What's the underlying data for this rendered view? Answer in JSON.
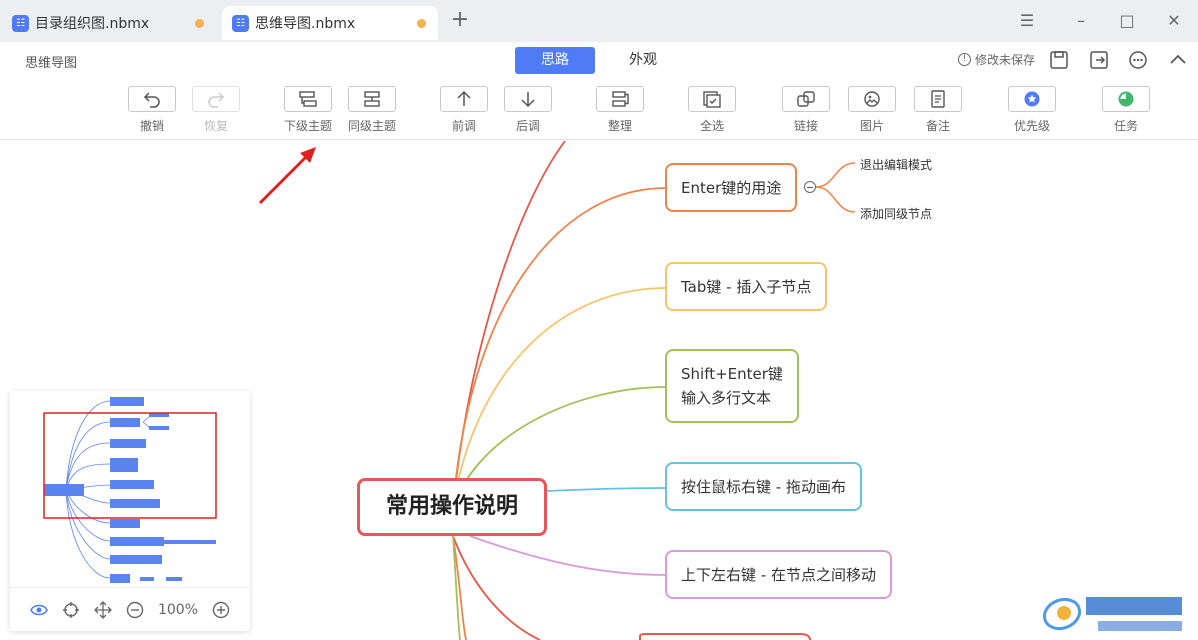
{
  "tabs": [
    {
      "label": "目录组织图.nbmx",
      "icon": "mindmap-file-icon",
      "unsaved": true
    },
    {
      "label": "思维导图.nbmx",
      "icon": "mindmap-file-icon",
      "unsaved": true
    }
  ],
  "window": {
    "new_tab": "+"
  },
  "header": {
    "app_title": "思维导图",
    "modes": [
      "思路",
      "外观"
    ],
    "active_mode": "思路",
    "unsaved_status": "修改未保存"
  },
  "toolbar": {
    "undo": "撤销",
    "redo": "恢复",
    "child_topic": "下级主题",
    "sibling_topic": "同级主题",
    "move_up": "前调",
    "move_down": "后调",
    "arrange": "整理",
    "select_all": "全选",
    "link": "链接",
    "image": "图片",
    "note": "备注",
    "priority": "优先级",
    "task": "任务"
  },
  "mindmap": {
    "root": "常用操作说明",
    "nodes": [
      {
        "text": "Enter键的用途",
        "color": "#f0834b"
      },
      {
        "text": "Tab键 - 插入子节点",
        "color": "#f6c46c"
      },
      {
        "text": "Shift+Enter键",
        "text2": "输入多行文本",
        "color": "#a4c058"
      },
      {
        "text": "按住鼠标右键 - 拖动画布",
        "color": "#66c1dd"
      },
      {
        "text": "上下左右键 - 在节点之间移动",
        "color": "#d89ad8"
      }
    ],
    "sub_nodes": [
      "退出编辑模式",
      "添加同级节点"
    ]
  },
  "minimap": {
    "zoom": "100%"
  },
  "colors": {
    "accent": "#4f7cf6",
    "root_border": "#e8555a",
    "annotation_arrow": "#e02020"
  }
}
